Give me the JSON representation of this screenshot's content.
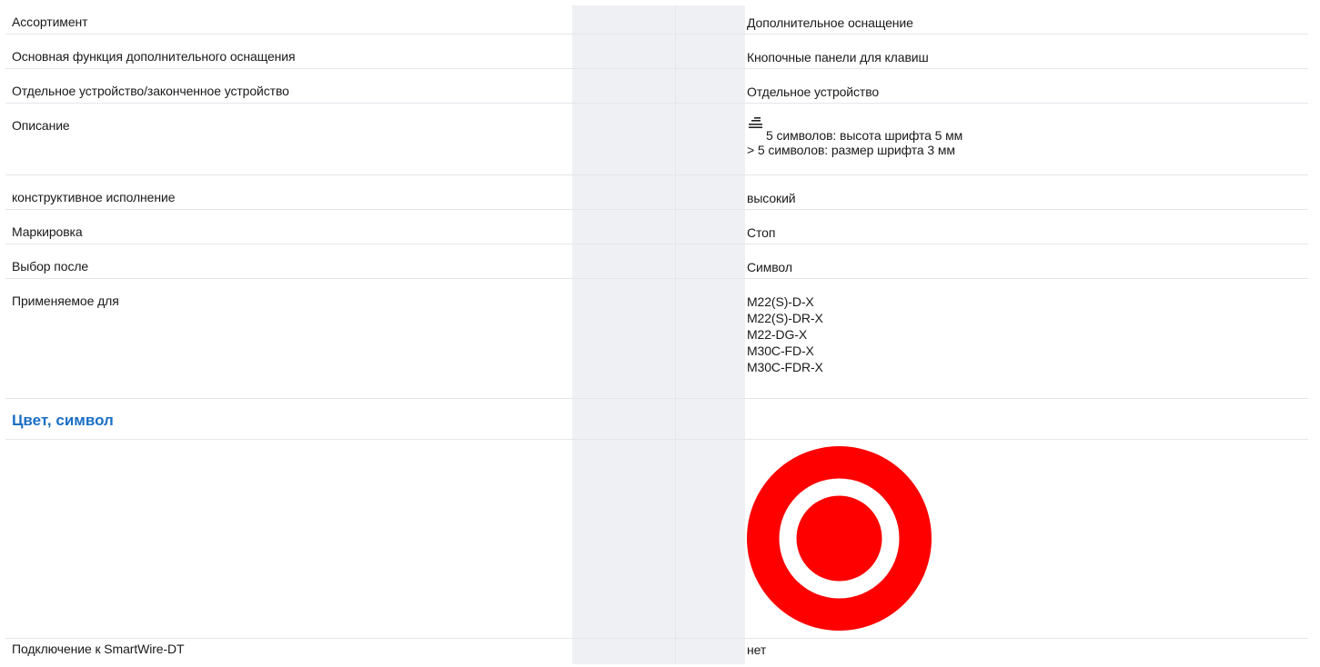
{
  "rows": [
    {
      "label": "Ассортимент",
      "value": "Дополнительное оснащение"
    },
    {
      "label": "Основная функция дополнительного оснащения",
      "value": "Кнопочные панели для клавиш"
    },
    {
      "label": "Отдельное устройство/законченное устройство",
      "value": "Отдельное устройство"
    },
    {
      "label": "Описание",
      "value_lines": [
        "5 символов: высота шрифта 5 мм",
        "> 5 символов: размер шрифта 3 мм"
      ],
      "icon": "text-lines-icon"
    },
    {
      "label": "конструктивное исполнение",
      "value": "высокий"
    },
    {
      "label": "Маркировка",
      "value": "Стоп"
    },
    {
      "label": "Выбор после",
      "value": "Символ"
    },
    {
      "label": "Применяемое для",
      "value_lines": [
        "M22(S)-D-X",
        "M22(S)-DR-X",
        "M22-DG-X",
        "M30C-FD-X",
        "M30C-FDR-X"
      ]
    }
  ],
  "section": {
    "title": "Цвет, символ",
    "color": "#1a6fc4"
  },
  "symbol": {
    "icon": "red-stop-target-symbol",
    "color": "#ff0000",
    "background": "#ffffff"
  },
  "last_row": {
    "label": "Подключение к SmartWire-DT",
    "value": "нет"
  }
}
